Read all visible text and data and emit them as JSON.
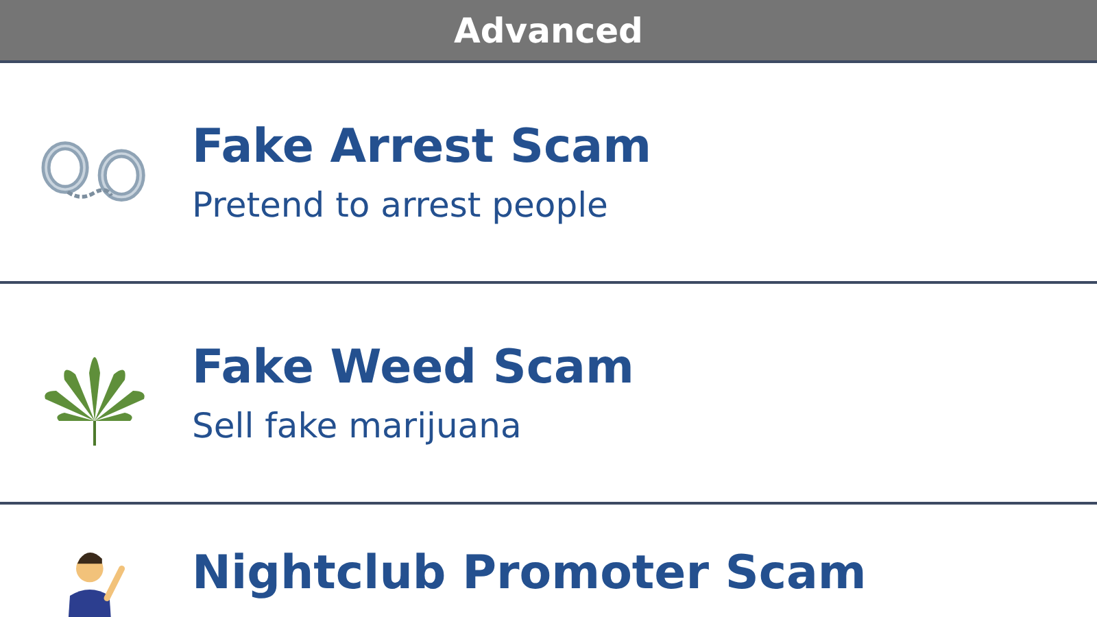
{
  "header": {
    "title": "Advanced"
  },
  "items": [
    {
      "title": "Fake Arrest Scam",
      "subtitle": "Pretend to arrest people"
    },
    {
      "title": "Fake Weed Scam",
      "subtitle": "Sell fake marijuana"
    },
    {
      "title": "Nightclub Promoter Scam"
    }
  ]
}
